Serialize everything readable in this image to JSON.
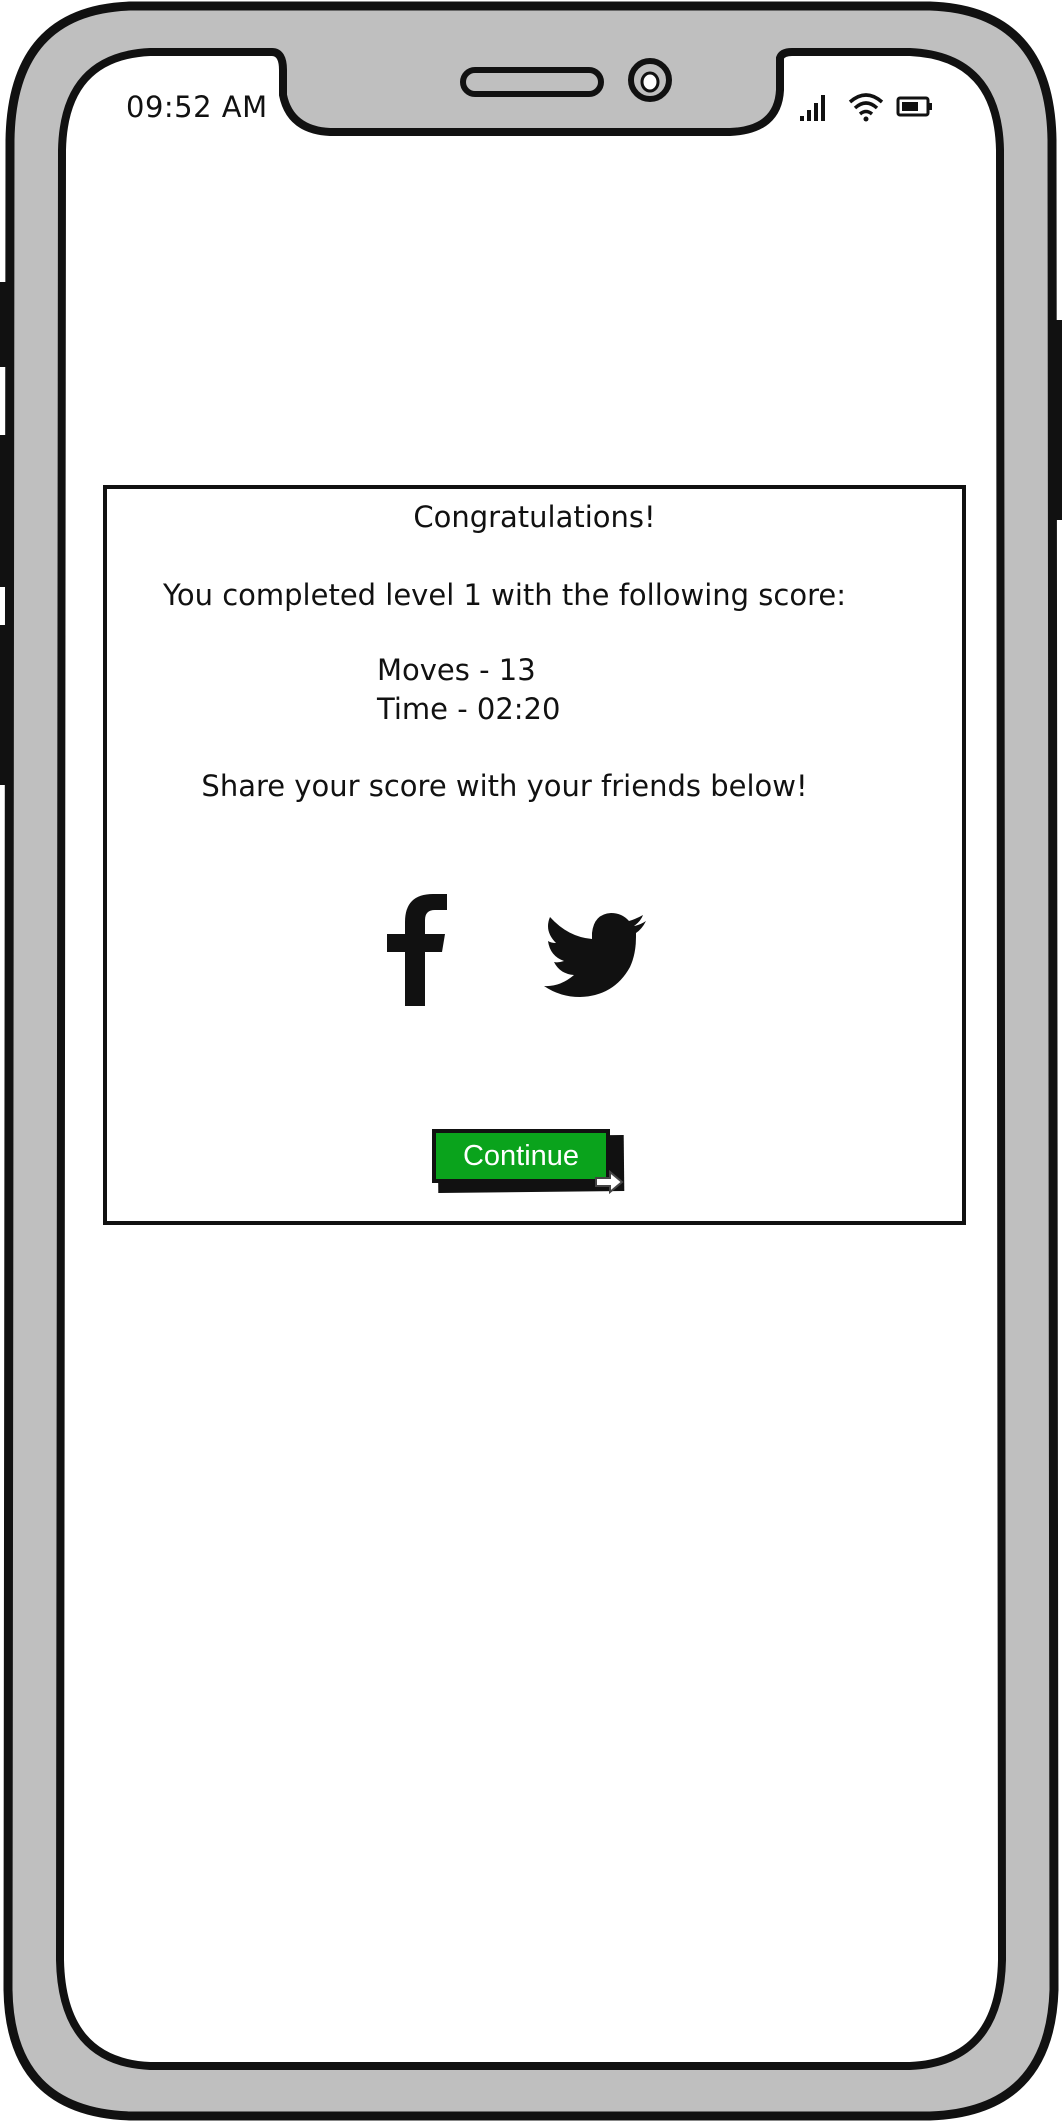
{
  "status_bar": {
    "time": "09:52 AM",
    "icons": [
      "signal-icon",
      "wifi-icon",
      "battery-icon"
    ]
  },
  "dialog": {
    "title": "Congratulations!",
    "message": "You completed level 1 with the following score:",
    "moves": "Moves - 13",
    "time": "Time - 02:20",
    "share_text": "Share your score with your friends below!",
    "share_icons": [
      "facebook-icon",
      "twitter-icon"
    ],
    "continue_label": "Continue"
  },
  "colors": {
    "phone_frame": "#bfbfbf",
    "outline": "#111111",
    "continue_button": "#0aa31c",
    "continue_text": "#ffffff"
  }
}
